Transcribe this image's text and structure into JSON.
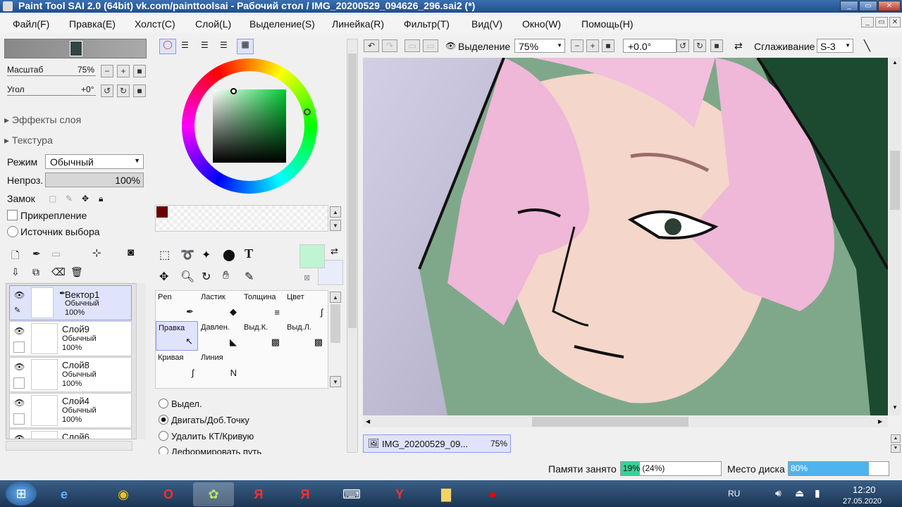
{
  "window": {
    "title": "Paint Tool SAI 2.0 (64bit) vk.com/painttoolsai - Рабочий стол / IMG_20200529_094626_296.sai2 (*)"
  },
  "menu": [
    "Файл(F)",
    "Правка(E)",
    "Холст(C)",
    "Слой(L)",
    "Выделение(S)",
    "Линейка(R)",
    "Фильтр(T)",
    "Вид(V)",
    "Окно(W)",
    "Помощь(H)"
  ],
  "navigator": {
    "scale_label": "Масштаб",
    "scale_value": "75%",
    "angle_label": "Угол",
    "angle_value": "+0°"
  },
  "layer_panel": {
    "effects": "Эффекты слоя",
    "texture": "Текстура",
    "mode_label": "Режим",
    "mode_value": "Обычный",
    "opacity_label": "Непроз.",
    "opacity_value": "100%",
    "lock_label": "Замок",
    "clip_label": "Прикрепление",
    "source_label": "Источник выбора",
    "layers": [
      {
        "name": "Вектор1",
        "mode": "Обычный",
        "opacity": "100%"
      },
      {
        "name": "Слой9",
        "mode": "Обычный",
        "opacity": "100%"
      },
      {
        "name": "Слой8",
        "mode": "Обычный",
        "opacity": "100%"
      },
      {
        "name": "Слой4",
        "mode": "Обычный",
        "opacity": "100%"
      },
      {
        "name": "Слой6",
        "mode": "",
        "opacity": ""
      }
    ]
  },
  "colors": {
    "primary": "#bff5d3",
    "secondary": "#e8ecfb",
    "palette_first": "#6b0000"
  },
  "tools": [
    {
      "label": "Pen"
    },
    {
      "label": "Ластик"
    },
    {
      "label": "Толщина"
    },
    {
      "label": "Цвет"
    },
    {
      "label": "Правка"
    },
    {
      "label": "Давлен."
    },
    {
      "label": "Выд.К."
    },
    {
      "label": "Выд.Л."
    },
    {
      "label": "Кривая"
    },
    {
      "label": "Линия"
    }
  ],
  "tool_options": [
    "Выдел.",
    "Двигать/Доб.Точку",
    "Удалить КТ/Кривую",
    "Деформировать путь"
  ],
  "toolbar": {
    "selection_label": "Выделение",
    "zoom": "75%",
    "rotation": "+0.0°",
    "smoothing_label": "Сглаживание",
    "smoothing_value": "S-3"
  },
  "document_tab": {
    "name": "IMG_20200529_09...",
    "zoom": "75%"
  },
  "status": {
    "memory_label": "Памяти занято",
    "memory_value": "19% (24%)",
    "memory_fraction": 0.19,
    "disk_label": "Место диска",
    "disk_value": "80%",
    "disk_fraction": 0.8
  },
  "taskbar": {
    "lang": "RU",
    "time": "12:20",
    "date": "27.05.2020"
  }
}
